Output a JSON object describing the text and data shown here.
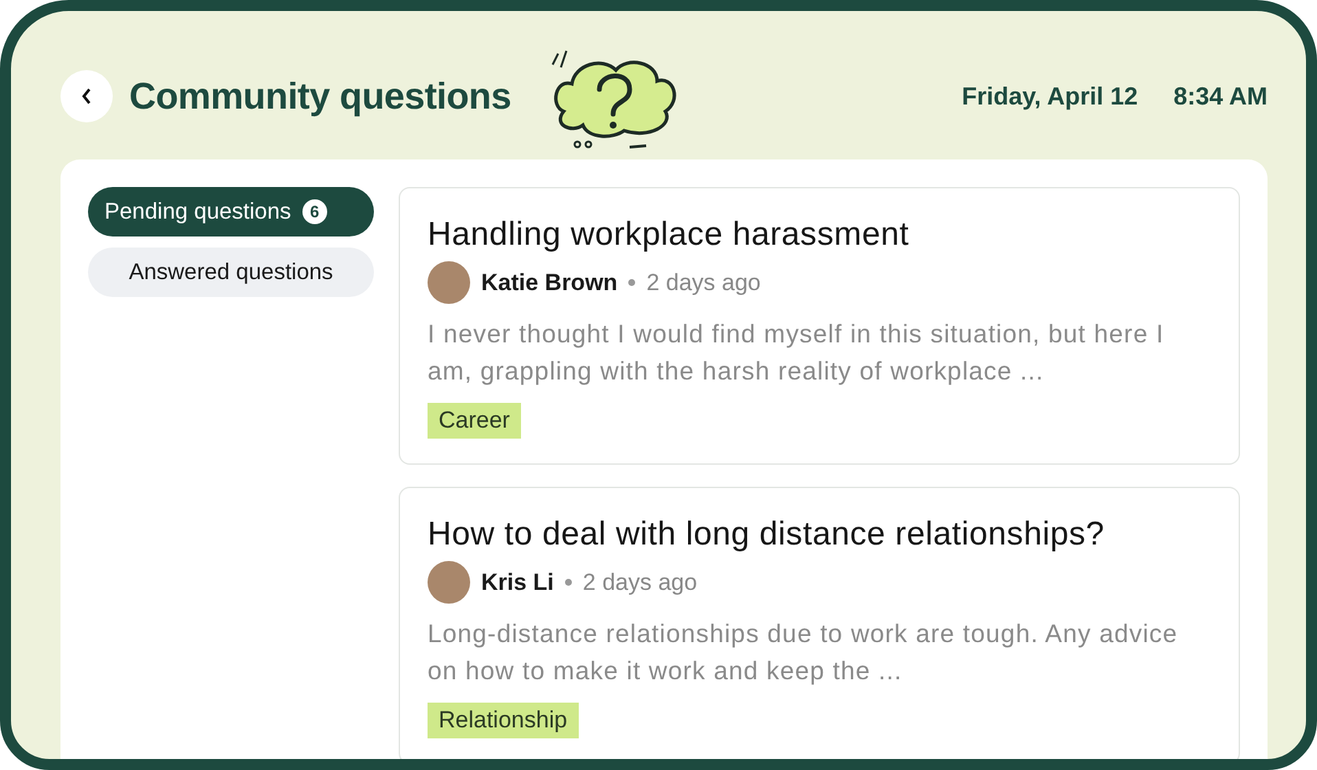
{
  "header": {
    "title": "Community questions",
    "date": "Friday, April 12",
    "time": "8:34 AM"
  },
  "filters": [
    {
      "label": "Pending questions",
      "count": "6",
      "selected": true
    },
    {
      "label": "Answered questions",
      "selected": false
    }
  ],
  "questions": [
    {
      "title": "Handling workplace harassment",
      "author": "Katie Brown",
      "time": "2 days ago",
      "excerpt": "I never thought I would find myself in this situation, but here I am, grappling with the harsh reality of workplace ...",
      "tag": "Career"
    },
    {
      "title": "How to deal with long distance relationships?",
      "author": "Kris Li",
      "time": "2 days ago",
      "excerpt": "Long-distance relationships due to work are tough. Any advice on how to make it work and keep the ...",
      "tag": "Relationship"
    }
  ]
}
